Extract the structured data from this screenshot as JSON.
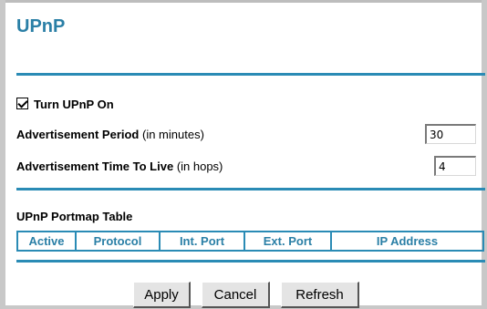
{
  "page": {
    "title": "UPnP"
  },
  "upnp": {
    "turn_on_label": "Turn UPnP On",
    "turn_on_checked": true,
    "adv_period_label": "Advertisement Period",
    "adv_period_unit": "(in minutes)",
    "adv_period_value": "30",
    "adv_ttl_label": "Advertisement Time To Live",
    "adv_ttl_unit": "(in hops)",
    "adv_ttl_value": "4"
  },
  "portmap": {
    "title": "UPnP Portmap Table",
    "columns": [
      "Active",
      "Protocol",
      "Int. Port",
      "Ext. Port",
      "IP Address"
    ]
  },
  "buttons": {
    "apply": "Apply",
    "cancel": "Cancel",
    "refresh": "Refresh"
  },
  "colors": {
    "accent": "#2a7fa6",
    "rule": "#2a8bb5",
    "frame": "#c8c8c8"
  }
}
